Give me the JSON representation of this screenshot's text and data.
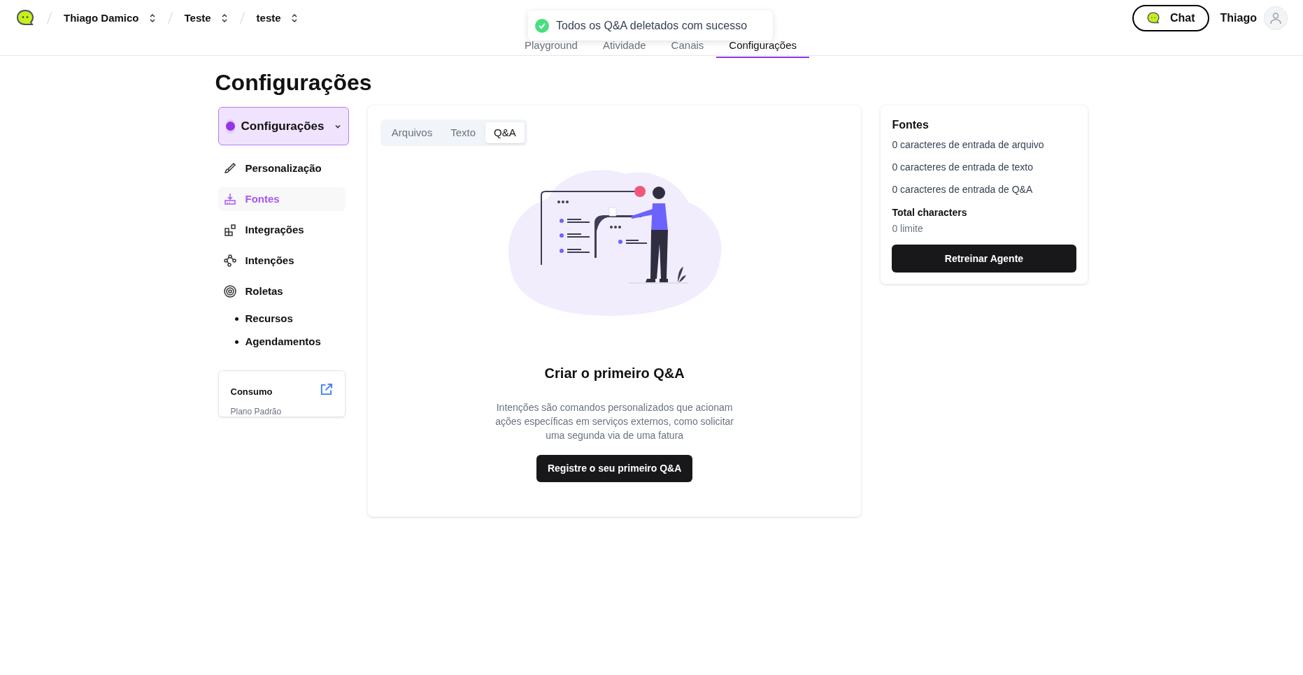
{
  "header": {
    "breadcrumbs": [
      {
        "label": "Thiago Damico"
      },
      {
        "label": "Teste"
      },
      {
        "label": "teste"
      }
    ],
    "nav_tabs": [
      {
        "label": "Playground",
        "selected": false
      },
      {
        "label": "Atividade",
        "selected": false
      },
      {
        "label": "Canais",
        "selected": false
      },
      {
        "label": "Configurações",
        "selected": true
      }
    ],
    "chat_button": "Chat",
    "user_name": "Thiago"
  },
  "toast": {
    "kind": "success",
    "message": "Todos os Q&A deletados com sucesso"
  },
  "page_title": "Configurações",
  "sidebar": {
    "dropdown": {
      "label": "Configurações"
    },
    "items": [
      {
        "kind": "main",
        "label": "Personalização",
        "selected": false
      },
      {
        "kind": "main",
        "label": "Fontes",
        "selected": true
      },
      {
        "kind": "main",
        "label": "Integrações",
        "selected": false
      },
      {
        "kind": "main",
        "label": "Intenções",
        "selected": false
      },
      {
        "kind": "main",
        "label": "Roletas",
        "selected": false
      },
      {
        "kind": "sub",
        "label": "Recursos",
        "selected": false
      },
      {
        "kind": "sub",
        "label": "Agendamentos",
        "selected": false
      }
    ],
    "usage_card": {
      "title": "Consumo",
      "plan": "Plano Padrão"
    }
  },
  "content": {
    "tabs": [
      {
        "label": "Arquivos",
        "selected": false
      },
      {
        "label": "Texto",
        "selected": false
      },
      {
        "label": "Q&A",
        "selected": true
      }
    ],
    "empty_state": {
      "title": "Criar o primeiro Q&A",
      "description": "Intenções são comandos personalizados que acionam ações específicas em serviços externos, como solicitar uma segunda via de uma fatura",
      "button": "Registre o seu primeiro Q&A"
    }
  },
  "sources_card": {
    "title": "Fontes",
    "lines": [
      "0 caracteres de entrada de arquivo",
      "0 caracteres de entrada de texto",
      "0 caracteres de entrada de Q&A"
    ],
    "total_label": "Total characters",
    "total_value": "0 limite",
    "button": "Retreinar Agente"
  }
}
